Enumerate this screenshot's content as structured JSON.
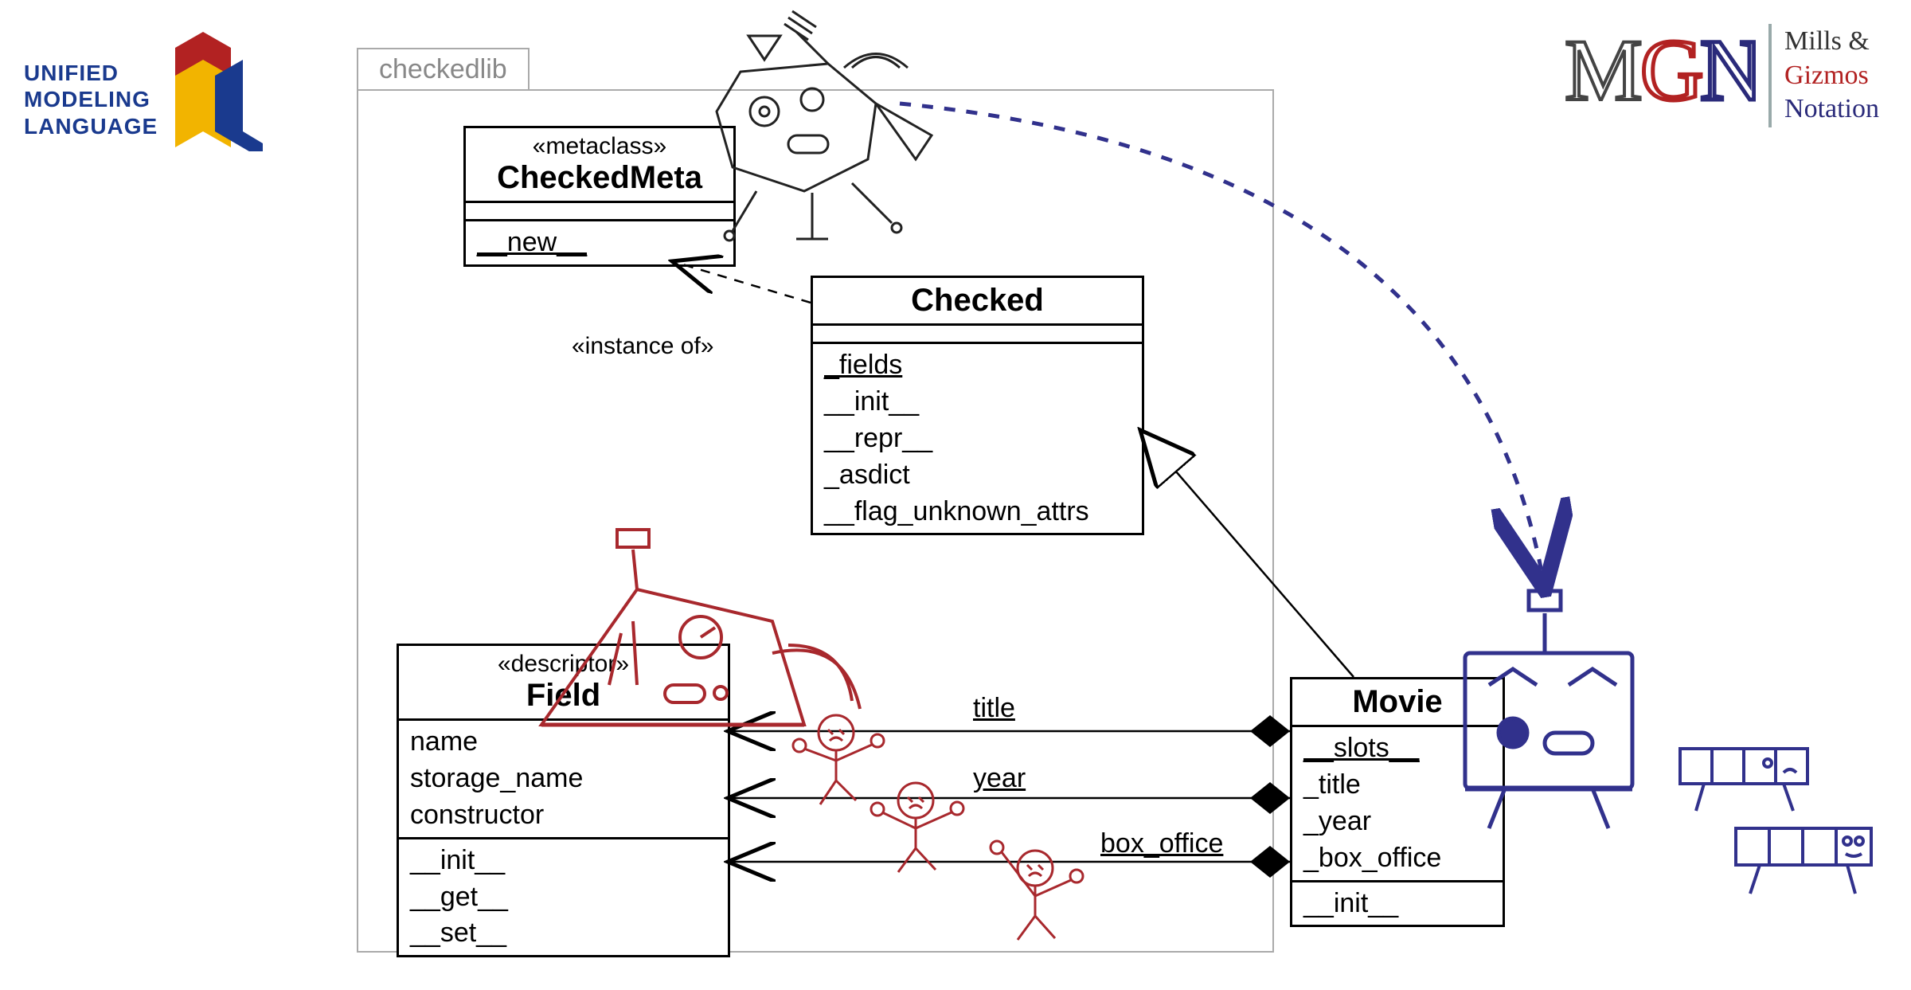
{
  "uml_logo": {
    "line1": "UNIFIED",
    "line2": "MODELING",
    "line3": "LANGUAGE"
  },
  "mgn_logo": {
    "line1": "Mills &",
    "line2": "Gizmos",
    "line3": "Notation"
  },
  "package_name": "checkedlib",
  "classes": {
    "checkedmeta": {
      "stereo": "«metaclass»",
      "name": "CheckedMeta",
      "ops": [
        "__new__"
      ]
    },
    "checked": {
      "name": "Checked",
      "attrs": [
        "_fields",
        "__init__",
        "__repr__",
        "_asdict",
        "__flag_unknown_attrs"
      ]
    },
    "field": {
      "stereo": "«descriptor»",
      "name": "Field",
      "attrs": [
        "name",
        "storage_name",
        "constructor"
      ],
      "ops": [
        "__init__",
        "__get__",
        "__set__"
      ]
    },
    "movie": {
      "name": "Movie",
      "attrs": [
        "__slots__",
        "_title",
        "_year",
        "_box_office"
      ],
      "ops": [
        "__init__"
      ]
    }
  },
  "relations": {
    "instance_of": "«instance of»",
    "assoc_title": "title",
    "assoc_year": "year",
    "assoc_box_office": "box_office"
  },
  "colors": {
    "uml_blue": "#1a3a8e",
    "mgn_red": "#b22222",
    "mgn_navy": "#2a2a7a",
    "doodle_red": "#a8282d",
    "doodle_navy": "#31318c"
  }
}
